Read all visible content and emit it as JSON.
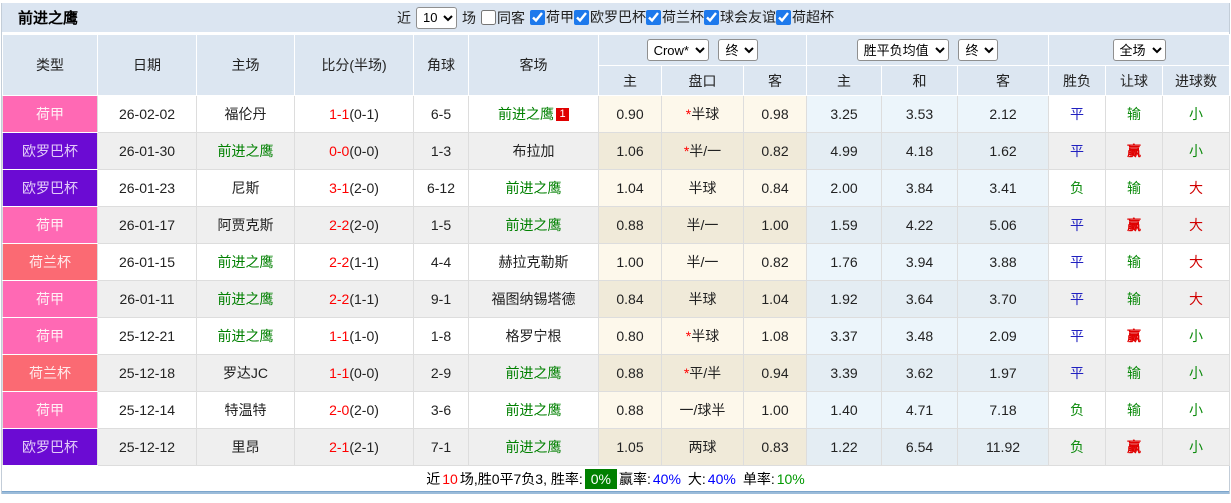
{
  "title": "前进之鹰",
  "topbar": {
    "near_label": "近",
    "recent_select": "10",
    "matches_label": "场",
    "same_away_label": "同客",
    "league_filters": [
      {
        "label": "荷甲",
        "checked": true
      },
      {
        "label": "欧罗巴杯",
        "checked": true
      },
      {
        "label": "荷兰杯",
        "checked": true
      },
      {
        "label": "球会友谊",
        "checked": true
      },
      {
        "label": "荷超杯",
        "checked": true
      }
    ]
  },
  "header": {
    "static_cols": [
      "类型",
      "日期",
      "主场",
      "比分(半场)",
      "角球",
      "客场"
    ],
    "sub_cols": [
      "主",
      "盘口",
      "客",
      "主",
      "和",
      "客",
      "胜负",
      "让球",
      "进球数"
    ],
    "bookmaker_select": "Crow*",
    "odds_time_select": "终",
    "avg_select": "胜平负均值",
    "avg_time_select": "终",
    "scope_select": "全场"
  },
  "league_colors": {
    "荷甲": {
      "bg": "#ff69b4",
      "fg": "#fff0f5"
    },
    "欧罗巴杯": {
      "bg": "#6b0bd3",
      "fg": "#e3ccf9"
    },
    "荷兰杯": {
      "bg": "#fb6a73",
      "fg": "#ffecec"
    }
  },
  "value_colors": {
    "平": "#2020c0",
    "负": "#0b8a0b",
    "输": "#0b8a0b",
    "赢": "#e00000",
    "小": "#0b8a0b",
    "大": "#d00000"
  },
  "rows": [
    {
      "league": "荷甲",
      "date": "26-02-02",
      "home": "福伦丹",
      "home_self": false,
      "score": "1-1",
      "half": "(0-1)",
      "corners": "6-5",
      "away": "前进之鹰",
      "away_self": true,
      "away_badge": "1",
      "crow_home": "0.90",
      "handicap_star": true,
      "handicap": "半球",
      "crow_away": "0.98",
      "avg_home": "3.25",
      "avg_draw": "3.53",
      "avg_away": "2.12",
      "wdl": "平",
      "let": "输",
      "goals": "小"
    },
    {
      "league": "欧罗巴杯",
      "date": "26-01-30",
      "home": "前进之鹰",
      "home_self": true,
      "score": "0-0",
      "half": "(0-0)",
      "corners": "1-3",
      "away": "布拉加",
      "away_self": false,
      "crow_home": "1.06",
      "handicap_star": true,
      "handicap": "半/一",
      "crow_away": "0.82",
      "avg_home": "4.99",
      "avg_draw": "4.18",
      "avg_away": "1.62",
      "wdl": "平",
      "let": "赢",
      "goals": "小"
    },
    {
      "league": "欧罗巴杯",
      "date": "26-01-23",
      "home": "尼斯",
      "home_self": false,
      "score": "3-1",
      "half": "(2-0)",
      "corners": "6-12",
      "away": "前进之鹰",
      "away_self": true,
      "crow_home": "1.04",
      "handicap_star": false,
      "handicap": "半球",
      "crow_away": "0.84",
      "avg_home": "2.00",
      "avg_draw": "3.84",
      "avg_away": "3.41",
      "wdl": "负",
      "let": "输",
      "goals": "大"
    },
    {
      "league": "荷甲",
      "date": "26-01-17",
      "home": "阿贾克斯",
      "home_self": false,
      "score": "2-2",
      "half": "(2-0)",
      "corners": "1-5",
      "away": "前进之鹰",
      "away_self": true,
      "crow_home": "0.88",
      "handicap_star": false,
      "handicap": "半/一",
      "crow_away": "1.00",
      "avg_home": "1.59",
      "avg_draw": "4.22",
      "avg_away": "5.06",
      "wdl": "平",
      "let": "赢",
      "goals": "大"
    },
    {
      "league": "荷兰杯",
      "date": "26-01-15",
      "home": "前进之鹰",
      "home_self": true,
      "score": "2-2",
      "half": "(1-1)",
      "corners": "4-4",
      "away": "赫拉克勒斯",
      "away_self": false,
      "crow_home": "1.00",
      "handicap_star": false,
      "handicap": "半/一",
      "crow_away": "0.82",
      "avg_home": "1.76",
      "avg_draw": "3.94",
      "avg_away": "3.88",
      "wdl": "平",
      "let": "输",
      "goals": "大"
    },
    {
      "league": "荷甲",
      "date": "26-01-11",
      "home": "前进之鹰",
      "home_self": true,
      "score": "2-2",
      "half": "(1-1)",
      "corners": "9-1",
      "away": "福图纳锡塔德",
      "away_self": false,
      "crow_home": "0.84",
      "handicap_star": false,
      "handicap": "半球",
      "crow_away": "1.04",
      "avg_home": "1.92",
      "avg_draw": "3.64",
      "avg_away": "3.70",
      "wdl": "平",
      "let": "输",
      "goals": "大"
    },
    {
      "league": "荷甲",
      "date": "25-12-21",
      "home": "前进之鹰",
      "home_self": true,
      "score": "1-1",
      "half": "(1-0)",
      "corners": "1-8",
      "away": "格罗宁根",
      "away_self": false,
      "crow_home": "0.80",
      "handicap_star": true,
      "handicap": "半球",
      "crow_away": "1.08",
      "avg_home": "3.37",
      "avg_draw": "3.48",
      "avg_away": "2.09",
      "wdl": "平",
      "let": "赢",
      "goals": "小"
    },
    {
      "league": "荷兰杯",
      "date": "25-12-18",
      "home": "罗达JC",
      "home_self": false,
      "score": "1-1",
      "half": "(0-0)",
      "corners": "2-9",
      "away": "前进之鹰",
      "away_self": true,
      "crow_home": "0.88",
      "handicap_star": true,
      "handicap": "平/半",
      "crow_away": "0.94",
      "avg_home": "3.39",
      "avg_draw": "3.62",
      "avg_away": "1.97",
      "wdl": "平",
      "let": "输",
      "goals": "小"
    },
    {
      "league": "荷甲",
      "date": "25-12-14",
      "home": "特温特",
      "home_self": false,
      "score": "2-0",
      "half": "(2-0)",
      "corners": "3-6",
      "away": "前进之鹰",
      "away_self": true,
      "crow_home": "0.88",
      "handicap_star": false,
      "handicap": "一/球半",
      "crow_away": "1.00",
      "avg_home": "1.40",
      "avg_draw": "4.71",
      "avg_away": "7.18",
      "wdl": "负",
      "let": "输",
      "goals": "小"
    },
    {
      "league": "欧罗巴杯",
      "date": "25-12-12",
      "home": "里昂",
      "home_self": false,
      "score": "2-1",
      "half": "(2-1)",
      "corners": "7-1",
      "away": "前进之鹰",
      "away_self": true,
      "crow_home": "1.05",
      "handicap_star": false,
      "handicap": "两球",
      "crow_away": "0.83",
      "avg_home": "1.22",
      "avg_draw": "6.54",
      "avg_away": "11.92",
      "wdl": "负",
      "let": "赢",
      "goals": "小"
    }
  ],
  "footer": {
    "near": "近",
    "count": "10",
    "stats": "场,胜0平7负3, 胜率:",
    "rate": "0%",
    "win_label": "赢率:",
    "win": "40%",
    "big_label": "大:",
    "big": "40%",
    "single_label": "单率:",
    "single": "10%"
  }
}
